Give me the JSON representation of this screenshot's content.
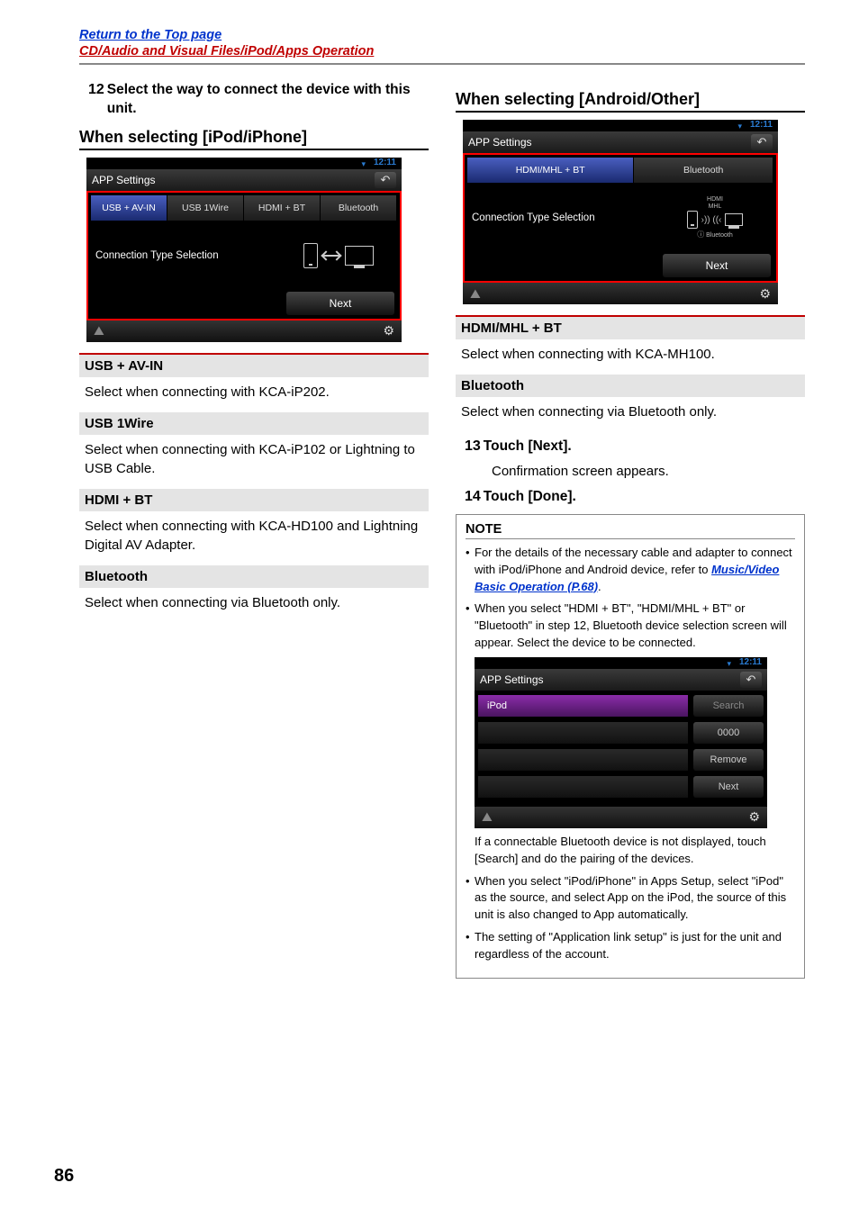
{
  "header": {
    "top_link": "Return to the Top page",
    "breadcrumb": "CD/Audio and Visual Files/iPod/Apps Operation"
  },
  "left": {
    "step12_num": "12",
    "step12_text": "Select the way to connect the device with this unit.",
    "subheading": "When selecting [iPod/iPhone]",
    "device": {
      "time": "12:11",
      "title": "APP Settings",
      "tabs": [
        "USB + AV-IN",
        "USB 1Wire",
        "HDMI + BT",
        "Bluetooth"
      ],
      "ct_label": "Connection Type Selection",
      "next": "Next"
    },
    "params": [
      {
        "head": "USB + AV-IN",
        "body": "Select when connecting with KCA-iP202."
      },
      {
        "head": "USB 1Wire",
        "body": "Select when connecting with KCA-iP102 or Lightning to USB Cable."
      },
      {
        "head": "HDMI + BT",
        "body": "Select when connecting with KCA-HD100 and Lightning Digital AV Adapter."
      },
      {
        "head": "Bluetooth",
        "body": "Select when connecting via Bluetooth only."
      }
    ]
  },
  "right": {
    "subheading": "When selecting [Android/Other]",
    "device": {
      "time": "12:11",
      "title": "APP Settings",
      "tabs": [
        "HDMI/MHL + BT",
        "Bluetooth"
      ],
      "ct_label": "Connection Type Selection",
      "illus_top": "HDMI",
      "illus_2": "MHL",
      "illus_bt": "Bluetooth",
      "next": "Next"
    },
    "params": [
      {
        "head": "HDMI/MHL + BT",
        "body": "Select when connecting with KCA-MH100."
      },
      {
        "head": "Bluetooth",
        "body": "Select when connecting via Bluetooth only."
      }
    ],
    "step13_num": "13",
    "step13_text": "Touch [Next].",
    "step13_desc": "Confirmation screen appears.",
    "step14_num": "14",
    "step14_text": "Touch [Done].",
    "note": {
      "head": "NOTE",
      "item1_a": "For the details of the necessary cable and adapter to connect with iPod/iPhone and Android device, refer to ",
      "item1_link": "Music/Video Basic Operation (P.68)",
      "item1_b": ".",
      "item2": "When you select \"HDMI + BT\", \"HDMI/MHL + BT\" or \"Bluetooth\" in step 12, Bluetooth device selection screen will appear. Select the device to be connected.",
      "device": {
        "time": "12:11",
        "title": "APP Settings",
        "list_item": "iPod",
        "btn_search": "Search",
        "btn_0000": "0000",
        "btn_remove": "Remove",
        "btn_next": "Next"
      },
      "item2_sub": "If a connectable Bluetooth device is not displayed, touch [Search] and do the pairing of the devices.",
      "item3": "When you select \"iPod/iPhone\" in Apps Setup, select \"iPod\" as the source, and select App on the iPod, the source of this unit is also changed to App automatically.",
      "item4": "The setting of \"Application link setup\" is just for the unit and regardless of the account."
    }
  },
  "page_number": "86"
}
